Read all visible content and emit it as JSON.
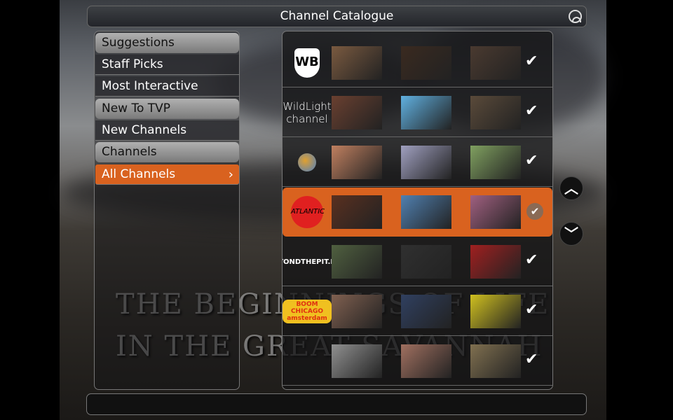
{
  "header": {
    "title": "Channel Catalogue",
    "home_icon": "home-icon"
  },
  "background_text": [
    "THE BEGINNINGS OF LIFE",
    "IN THE GREAT SAVANNAH"
  ],
  "menu": [
    {
      "label": "Suggestions",
      "type": "header"
    },
    {
      "label": "Staff Picks",
      "type": "item"
    },
    {
      "label": "Most Interactive",
      "type": "item"
    },
    {
      "label": "New To TVP",
      "type": "header"
    },
    {
      "label": "New Channels",
      "type": "item"
    },
    {
      "label": "Channels",
      "type": "header"
    },
    {
      "label": "All Channels",
      "type": "item",
      "selected": true,
      "chevron": "›"
    }
  ],
  "channels": [
    {
      "logo": "WB",
      "subscribed": true,
      "thumbs": [
        "#7a5a40",
        "#3a2a20",
        "#4a3a30"
      ]
    },
    {
      "logo": "WildLight channel",
      "subscribed": true,
      "thumbs": [
        "#6a4030",
        "#60b0e0",
        "#5a4a3a"
      ]
    },
    {
      "logo": "globe",
      "subscribed": true,
      "thumbs": [
        "#c08060",
        "#a0a0c0",
        "#80a060"
      ]
    },
    {
      "logo": "ATLANTIC",
      "subscribed": true,
      "selected": true,
      "thumbs": [
        "#5a3020",
        "#5080b0",
        "#a06080"
      ]
    },
    {
      "logo": "BEYONDTHEPIT.NET",
      "subscribed": true,
      "thumbs": [
        "#506040",
        "#303030",
        "#a02020"
      ]
    },
    {
      "logo": "BOOM CHICAGO amsterdam",
      "subscribed": true,
      "thumbs": [
        "#806050",
        "#304060",
        "#d0c020"
      ]
    },
    {
      "logo": "",
      "subscribed": true,
      "thumbs": [
        "#909090",
        "#a07060",
        "#807050"
      ]
    }
  ],
  "check_glyph": "✔",
  "scroll": {
    "up": "⌃",
    "down": "⌄"
  },
  "colors": {
    "accent": "#d9621f"
  }
}
